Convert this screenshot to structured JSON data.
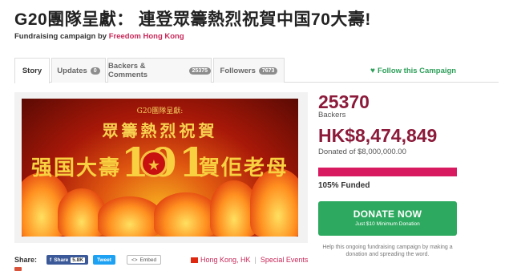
{
  "header": {
    "title": "G20團隊呈獻： 連登眾籌熱烈祝賀中国70大壽!",
    "subtitle_prefix": "Fundraising campaign by",
    "organizer": "Freedom Hong Kong"
  },
  "tabs": [
    {
      "label": "Story",
      "count": null,
      "active": true
    },
    {
      "label": "Updates",
      "count": "0",
      "active": false
    },
    {
      "label": "Backers & Comments",
      "count": "25375",
      "active": false
    },
    {
      "label": "Followers",
      "count": "7673",
      "active": false
    }
  ],
  "follow_label": "Follow this Campaign",
  "banner": {
    "top_text": "G20團隊呈獻:",
    "headline": "眾籌熱烈祝賀",
    "left_text": "强国大壽",
    "right_text": "賀佢老母",
    "number_left": "10",
    "number_right": "1"
  },
  "stats": {
    "backers_count": "25370",
    "backers_label": "Backers",
    "amount": "HK$8,474,849",
    "goal_text": "Donated of $8,000,000.00",
    "funded_percent": 105,
    "funded_label": "105% Funded"
  },
  "donate": {
    "label": "DONATE NOW",
    "sublabel": "Just $10 Minimum Donation"
  },
  "help_text": "Help this ongoing fundraising campaign by making a donation and spreading the word.",
  "share": {
    "label": "Share:",
    "facebook_label": "Share",
    "facebook_count": "5.8K",
    "twitter_label": "Tweet",
    "embed_label": "Embed"
  },
  "location": "Hong Kong, HK",
  "category": "Special Events",
  "colors": {
    "brand": "#c8285a",
    "amount": "#8c1a3a",
    "donate": "#2eaa60",
    "progress": "#d81b60",
    "follow": "#2e9f5a"
  }
}
